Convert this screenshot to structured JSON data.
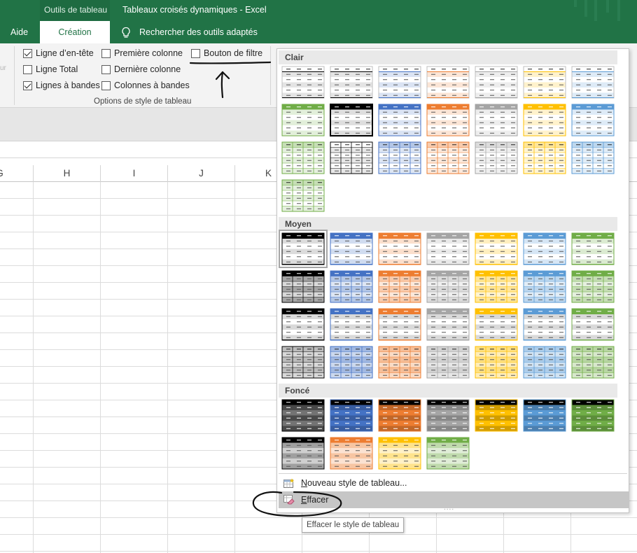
{
  "titlebar": {
    "context_group": "Outils de tableau",
    "title": "Tableaux croisés dynamiques  -  Excel"
  },
  "tabs": [
    {
      "label": "Aide"
    },
    {
      "label": "Création"
    }
  ],
  "tell_me": {
    "label": "Rechercher des outils adaptés",
    "icon": "lightbulb-icon"
  },
  "ribbon": {
    "options": [
      {
        "label": "Ligne d’en-tête",
        "checked": true
      },
      {
        "label": "Ligne Total",
        "checked": false
      },
      {
        "label": "Lignes à bandes",
        "checked": true
      },
      {
        "label": "Première colonne",
        "checked": false
      },
      {
        "label": "Dernière colonne",
        "checked": false
      },
      {
        "label": "Colonnes à bandes",
        "checked": false
      },
      {
        "label": "Bouton de filtre",
        "checked": false
      }
    ],
    "group_label": "Options de style de tableau",
    "cut_left_text": "ur"
  },
  "columns": [
    "G",
    "H",
    "I",
    "J",
    "K"
  ],
  "gallery": {
    "sections": [
      {
        "name": "Clair",
        "colors": [
          "#000000",
          "#000000",
          "#4472c4",
          "#ed7d31",
          "#a5a5a5",
          "#ffc000",
          "#5b9bd5",
          "#70ad47",
          "#000000",
          "#4472c4",
          "#ed7d31",
          "#a5a5a5",
          "#ffc000",
          "#5b9bd5",
          "#70ad47",
          "#000000",
          "#4472c4",
          "#ed7d31",
          "#a5a5a5",
          "#ffc000",
          "#5b9bd5",
          "#70ad47"
        ]
      },
      {
        "name": "Moyen",
        "colors": [
          "#000000",
          "#4472c4",
          "#ed7d31",
          "#a5a5a5",
          "#ffc000",
          "#5b9bd5",
          "#70ad47",
          "#000000",
          "#4472c4",
          "#ed7d31",
          "#a5a5a5",
          "#ffc000",
          "#5b9bd5",
          "#70ad47",
          "#000000",
          "#4472c4",
          "#ed7d31",
          "#a5a5a5",
          "#ffc000",
          "#5b9bd5",
          "#70ad47",
          "#000000",
          "#4472c4",
          "#ed7d31",
          "#a5a5a5",
          "#ffc000",
          "#5b9bd5",
          "#70ad47"
        ]
      },
      {
        "name": "Foncé",
        "colors": [
          "#000000",
          "#4472c4",
          "#ed7d31",
          "#a5a5a5",
          "#ffc000",
          "#5b9bd5",
          "#70ad47",
          "#000000",
          "#ed7d31",
          "#ffc000",
          "#70ad47"
        ]
      }
    ],
    "new_style": {
      "underline": "N",
      "rest": "ouveau style de tableau..."
    },
    "clear": {
      "underline": "E",
      "rest": "ffacer"
    },
    "more_dots": "...."
  },
  "tooltip": "Effacer le style de tableau",
  "colors": {
    "excel_green": "#217346",
    "ribbon_bg": "#f3f3f3",
    "highlight": "#c6c6c6"
  }
}
